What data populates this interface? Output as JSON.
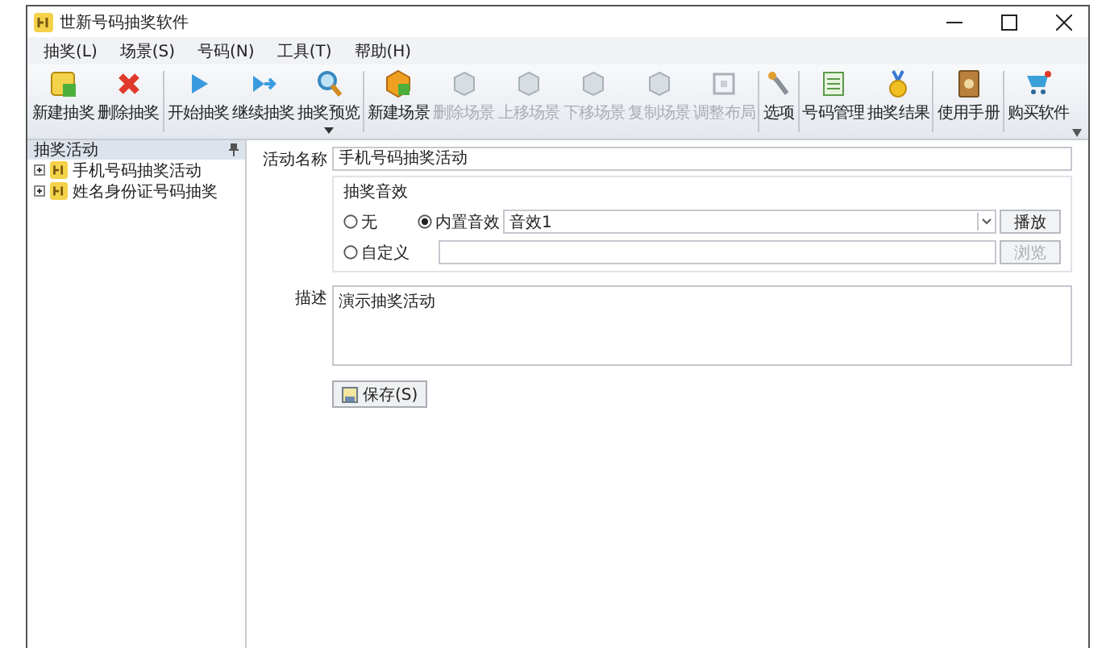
{
  "window": {
    "title": "世新号码抽奖软件"
  },
  "menu": [
    "抽奖(L)",
    "场景(S)",
    "号码(N)",
    "工具(T)",
    "帮助(H)"
  ],
  "toolbar": [
    {
      "separator_before": false,
      "label": "新建抽奖",
      "disabled": false
    },
    {
      "separator_before": false,
      "label": "删除抽奖",
      "disabled": false
    },
    {
      "separator_before": true,
      "label": "开始抽奖",
      "disabled": false
    },
    {
      "separator_before": false,
      "label": "继续抽奖",
      "disabled": false
    },
    {
      "separator_before": false,
      "label": "抽奖预览",
      "disabled": false,
      "dropdown": true
    },
    {
      "separator_before": true,
      "label": "新建场景",
      "disabled": false
    },
    {
      "separator_before": false,
      "label": "删除场景",
      "disabled": true
    },
    {
      "separator_before": false,
      "label": "上移场景",
      "disabled": true
    },
    {
      "separator_before": false,
      "label": "下移场景",
      "disabled": true
    },
    {
      "separator_before": false,
      "label": "复制场景",
      "disabled": true
    },
    {
      "separator_before": false,
      "label": "调整布局",
      "disabled": true
    },
    {
      "separator_before": true,
      "label": "选项",
      "disabled": false
    },
    {
      "separator_before": true,
      "label": "号码管理",
      "disabled": false
    },
    {
      "separator_before": false,
      "label": "抽奖结果",
      "disabled": false
    },
    {
      "separator_before": true,
      "label": "使用手册",
      "disabled": false
    },
    {
      "separator_before": true,
      "label": "购买软件",
      "disabled": false
    }
  ],
  "sidebar": {
    "title": "抽奖活动",
    "items": [
      {
        "label": "手机号码抽奖活动",
        "expanded": false,
        "selected": false
      },
      {
        "label": "姓名身份证号码抽奖",
        "expanded": false,
        "selected": false
      }
    ]
  },
  "form": {
    "name_label": "活动名称",
    "name_value": "手机号码抽奖活动",
    "sound": {
      "title": "抽奖音效",
      "options": [
        {
          "label": "无",
          "selected": false
        },
        {
          "label": "内置音效",
          "selected": true
        },
        {
          "label": "自定义",
          "selected": false
        }
      ],
      "builtin_value": "音效1",
      "play_button": {
        "label": "播放",
        "disabled": false
      },
      "browse_button": {
        "label": "浏览",
        "disabled": true
      }
    },
    "description_label": "描述",
    "description_value": "演示抽奖活动",
    "save_button": "保存(S)"
  }
}
